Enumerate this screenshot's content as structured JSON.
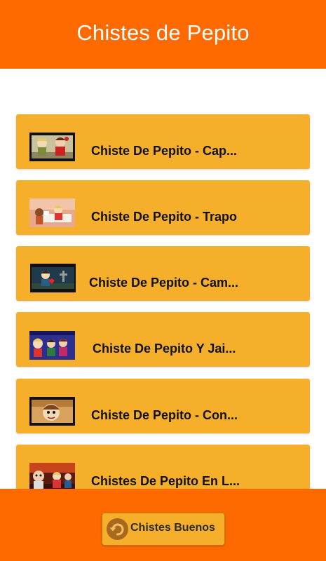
{
  "app": {
    "title": "Chistes de Pepito"
  },
  "videos": [
    {
      "title": "Chiste De Pepito - Cap...",
      "thumbnail": "cartoon-kids-thumbnail"
    },
    {
      "title": "Chiste De Pepito - Trapo",
      "thumbnail": "cartoon-bedroom-thumbnail"
    },
    {
      "title": "Chiste De Pepito - Cam...",
      "thumbnail": "cartoon-cemetery-thumbnail"
    },
    {
      "title": "Chiste De Pepito Y Jai...",
      "thumbnail": "cartoon-jaimito-thumbnail"
    },
    {
      "title": "Chiste De Pepito - Con...",
      "thumbnail": "cartoon-boy-closeup-thumbnail"
    },
    {
      "title": "Chistes De Pepito En L...",
      "thumbnail": "cartoon-class-thumbnail"
    }
  ],
  "footer": {
    "button_label": "Chistes Buenos",
    "button_icon": "undo-arrow-icon"
  },
  "colors": {
    "app_bar": "#FF6A00",
    "card": "#F6AF2A",
    "footer": "#FF6A00"
  }
}
